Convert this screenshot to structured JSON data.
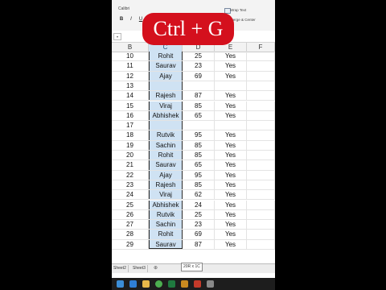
{
  "ribbon": {
    "font_name": "Calibri",
    "bold": "B",
    "italic": "I",
    "underline": "U",
    "wrap_text": "Wrap Text",
    "merge_center": "Merge & Center"
  },
  "overlay": {
    "label": "Ctrl + G",
    "color": "#d4101d"
  },
  "columns": [
    "B",
    "C",
    "D",
    "E",
    "F"
  ],
  "rows": [
    {
      "b": "10",
      "c": "Rohit",
      "d": "25",
      "e": "Yes"
    },
    {
      "b": "11",
      "c": "Saurav",
      "d": "23",
      "e": "Yes"
    },
    {
      "b": "12",
      "c": "Ajay",
      "d": "69",
      "e": "Yes"
    },
    {
      "b": "13",
      "c": "",
      "d": "",
      "e": ""
    },
    {
      "b": "14",
      "c": "Rajesh",
      "d": "87",
      "e": "Yes"
    },
    {
      "b": "15",
      "c": "Viraj",
      "d": "85",
      "e": "Yes"
    },
    {
      "b": "16",
      "c": "Abhishek",
      "d": "65",
      "e": "Yes"
    },
    {
      "b": "17",
      "c": "",
      "d": "",
      "e": ""
    },
    {
      "b": "18",
      "c": "Rutvik",
      "d": "95",
      "e": "Yes"
    },
    {
      "b": "19",
      "c": "Sachin",
      "d": "85",
      "e": "Yes"
    },
    {
      "b": "20",
      "c": "Rohit",
      "d": "85",
      "e": "Yes"
    },
    {
      "b": "21",
      "c": "Saurav",
      "d": "65",
      "e": "Yes"
    },
    {
      "b": "22",
      "c": "Ajay",
      "d": "95",
      "e": "Yes"
    },
    {
      "b": "23",
      "c": "Rajesh",
      "d": "85",
      "e": "Yes"
    },
    {
      "b": "24",
      "c": "Viraj",
      "d": "62",
      "e": "Yes"
    },
    {
      "b": "25",
      "c": "Abhishek",
      "d": "24",
      "e": "Yes"
    },
    {
      "b": "26",
      "c": "Rutvik",
      "d": "25",
      "e": "Yes"
    },
    {
      "b": "27",
      "c": "Sachin",
      "d": "23",
      "e": "Yes"
    },
    {
      "b": "28",
      "c": "Rohit",
      "d": "69",
      "e": "Yes"
    },
    {
      "b": "29",
      "c": "Saurav",
      "d": "87",
      "e": "Yes"
    }
  ],
  "sheet_tabs": [
    "Sheet2",
    "Sheet3"
  ],
  "add_tab_icon": "add-sheet-icon",
  "selection_tooltip": "20R x 1C",
  "colors": {
    "selection": "#cfe2f3",
    "taskbar": "#1d1d1d"
  }
}
